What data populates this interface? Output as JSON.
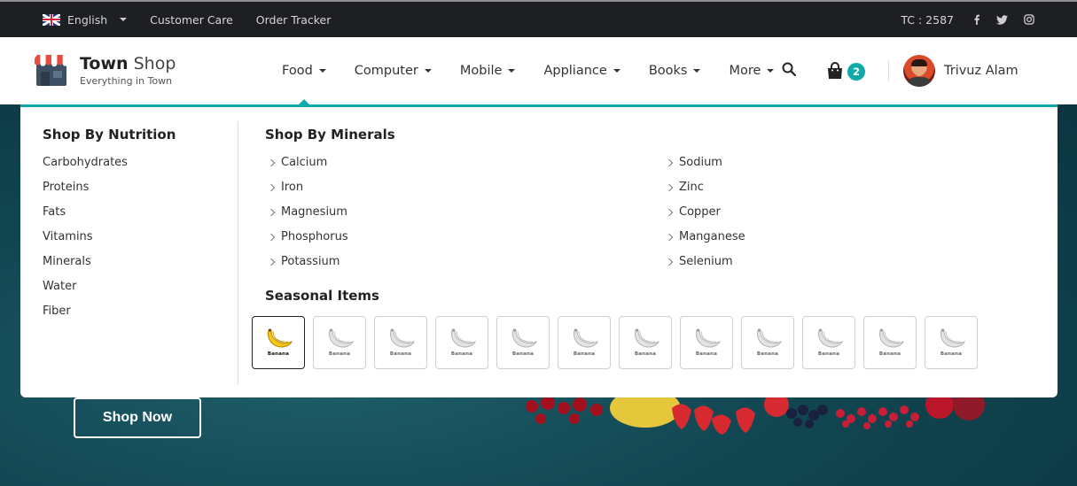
{
  "topbar": {
    "language": "English",
    "links": [
      "Customer Care",
      "Order Tracker"
    ],
    "tc_label": "TC : 2587",
    "social": [
      "facebook-icon",
      "twitter-icon",
      "instagram-icon"
    ]
  },
  "header": {
    "brand_bold": "Town",
    "brand_light": "Shop",
    "tagline": "Everything in Town",
    "nav": [
      "Food",
      "Computer",
      "Mobile",
      "Appliance",
      "Books",
      "More"
    ],
    "cart_count": "2",
    "user_name": "Trivuz Alam"
  },
  "mega_menu": {
    "nutrition_title": "Shop By Nutrition",
    "nutrition_items": [
      "Carbohydrates",
      "Proteins",
      "Fats",
      "Vitamins",
      "Minerals",
      "Water",
      "Fiber"
    ],
    "minerals_title": "Shop By Minerals",
    "minerals_left": [
      "Calcium",
      "Iron",
      "Magnesium",
      "Phosphorus",
      "Potassium"
    ],
    "minerals_right": [
      "Sodium",
      "Zinc",
      "Copper",
      "Manganese",
      "Selenium"
    ],
    "seasonal_title": "Seasonal Items",
    "seasonal_label": "Banana"
  },
  "hero": {
    "cta": "Shop Now"
  },
  "colors": {
    "accent": "#12a9a9",
    "topbar_bg": "#1d1f22",
    "hero_bg": "#0f3a45"
  }
}
